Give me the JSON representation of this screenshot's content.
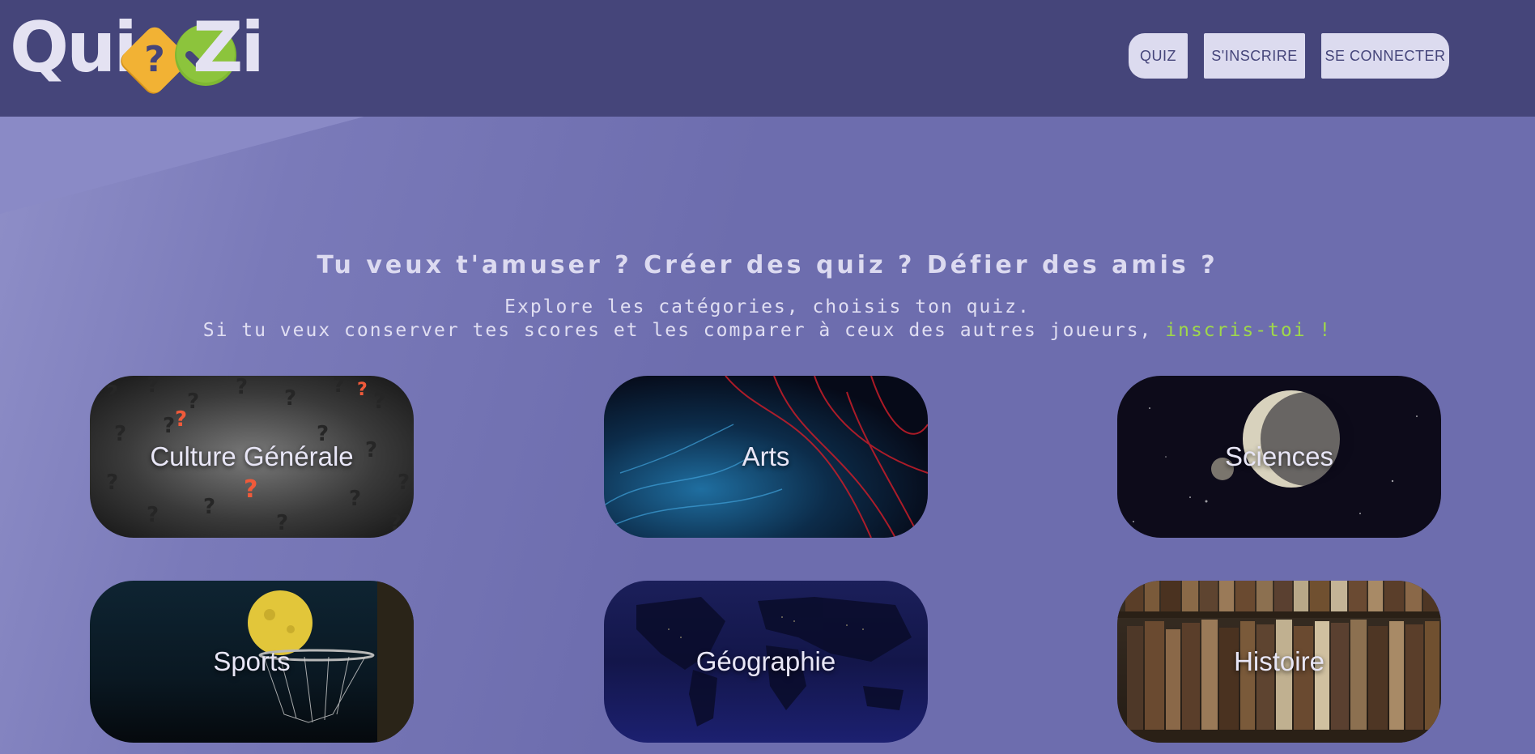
{
  "brand": {
    "logo_left": "Qui",
    "logo_question": "?",
    "logo_right": "Zi",
    "colors": {
      "header": "#45457a",
      "background": "#6d6dae",
      "accent_green": "#9fd84a",
      "logo_yellow": "#f2b234",
      "logo_green": "#8cc43c"
    }
  },
  "nav": {
    "quiz_label": "QUIZ",
    "register_label": "S'INSCRIRE",
    "login_label": "SE CONNECTER"
  },
  "hero": {
    "title": "Tu veux t'amuser ? Créer des quiz ? Défier des amis ?",
    "line1": "Explore les catégories, choisis ton quiz.",
    "line2_text": "Si tu veux conserver tes scores et les comparer à ceux des autres joueurs, ",
    "line2_link": "inscris-toi !"
  },
  "categories": [
    {
      "label": "Culture Générale",
      "icon": "question-marks-image"
    },
    {
      "label": "Arts",
      "icon": "abstract-lights-image"
    },
    {
      "label": "Sciences",
      "icon": "planet-image"
    },
    {
      "label": "Sports",
      "icon": "basketball-hoop-moon-image"
    },
    {
      "label": "Géographie",
      "icon": "world-map-night-image"
    },
    {
      "label": "Histoire",
      "icon": "old-books-image"
    }
  ]
}
